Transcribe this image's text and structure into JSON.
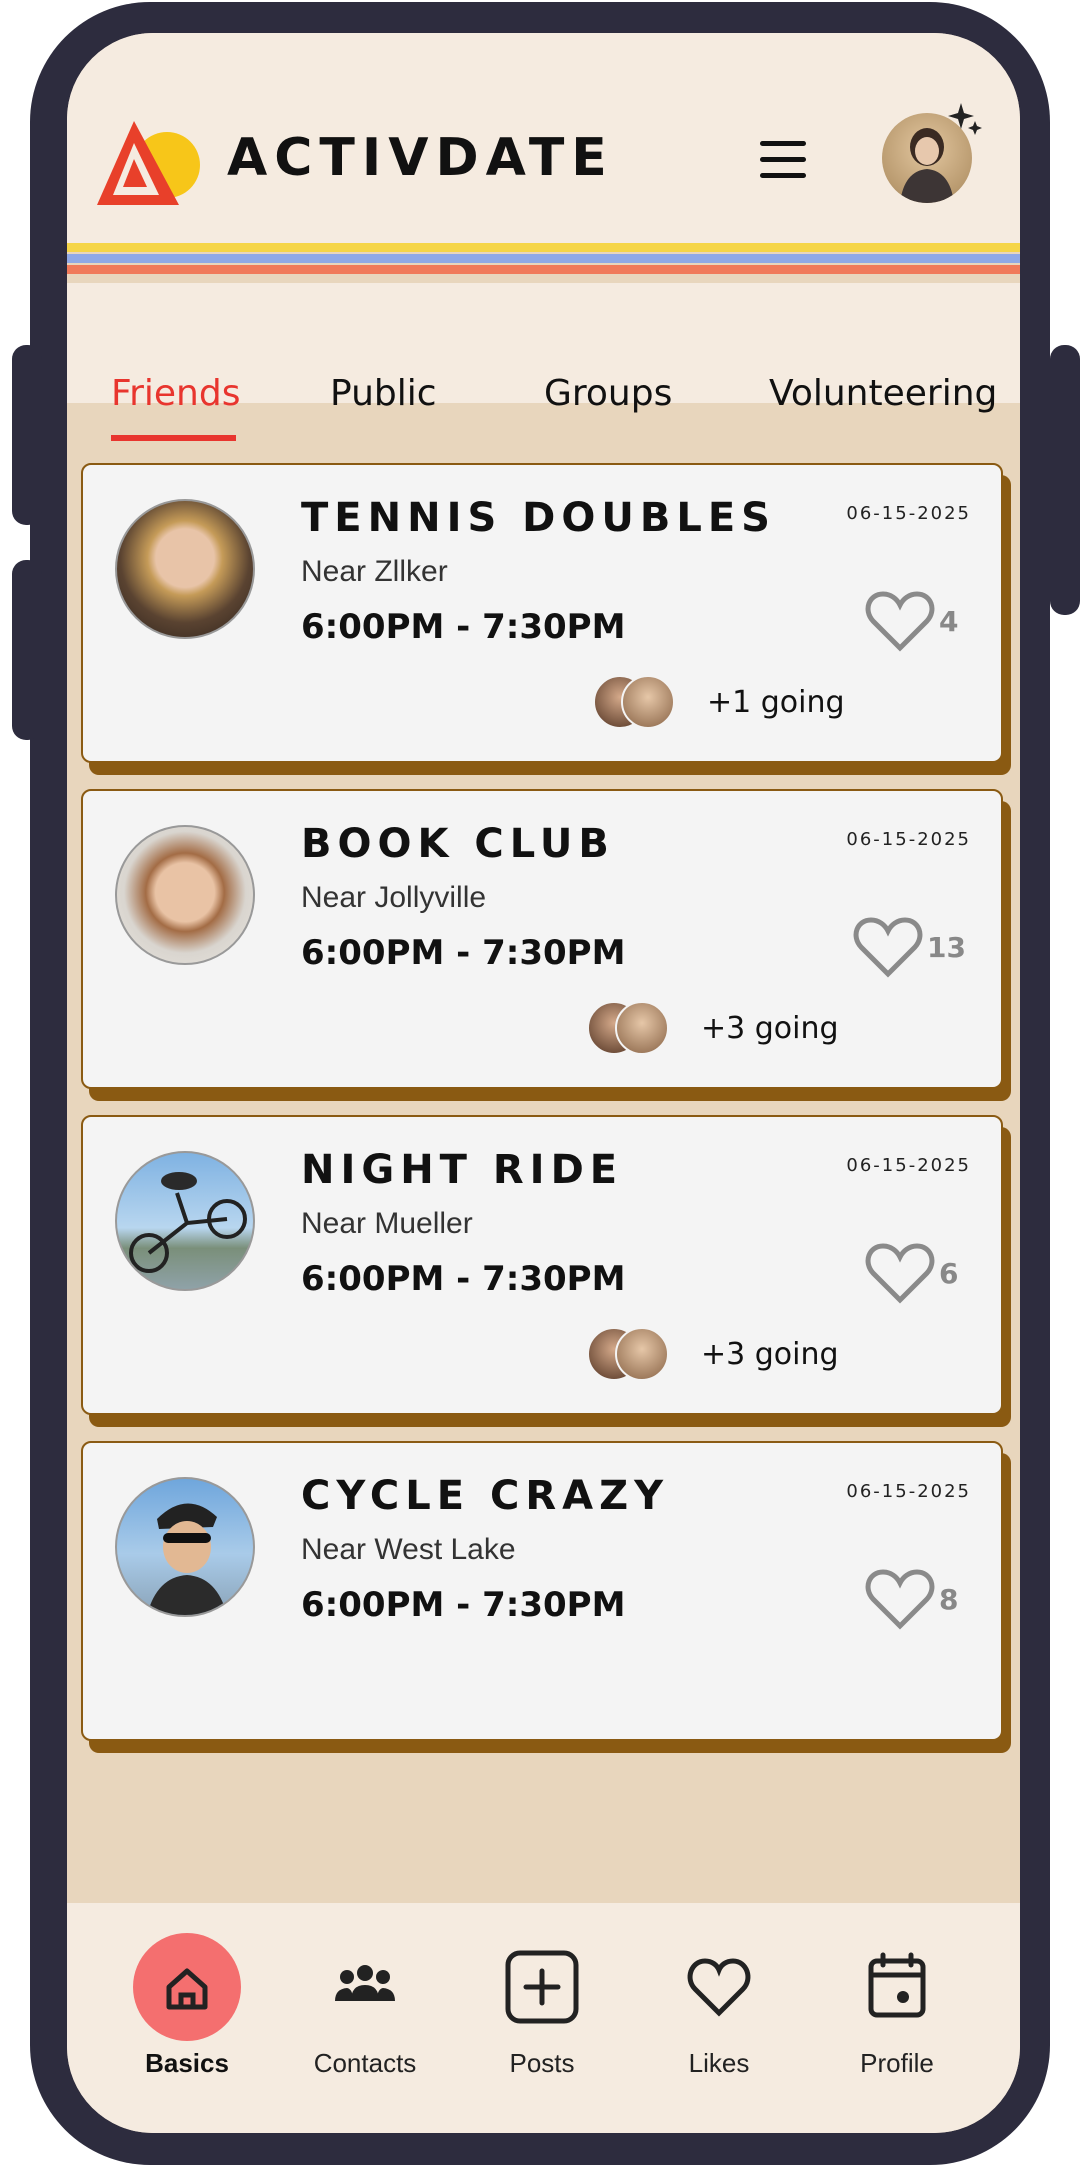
{
  "app": {
    "brand": "ACTIVDATE",
    "colors": {
      "accent": "#e8352e",
      "card_border": "#8a5a12",
      "stripe_yellow": "#f5d547",
      "stripe_blue": "#8fa9e6",
      "stripe_orange": "#f07a5a",
      "stripe_red": "#e8352e",
      "home_active": "#f46f6f"
    }
  },
  "header": {
    "menu_icon": "hamburger-menu-icon",
    "avatar_icon": "profile-avatar"
  },
  "tabs": [
    {
      "label": "Friends",
      "active": true
    },
    {
      "label": "Public",
      "active": false
    },
    {
      "label": "Groups",
      "active": false
    },
    {
      "label": "Volunteering",
      "active": false
    }
  ],
  "events": [
    {
      "title": "TENNIS DOUBLES",
      "date": "06-15-2025",
      "location": "Near Zllker",
      "time": "6:00PM - 7:30PM",
      "likes": "4",
      "going": "+1 going",
      "photo": "woman-portrait"
    },
    {
      "title": "BOOK CLUB",
      "date": "06-15-2025",
      "location": "Near Jollyville",
      "time": "6:00PM - 7:30PM",
      "likes": "13",
      "going": "+3 going",
      "photo": "man-portrait"
    },
    {
      "title": "NIGHT RIDE",
      "date": "06-15-2025",
      "location": "Near Mueller",
      "time": "6:00PM - 7:30PM",
      "likes": "6",
      "going": "+3 going",
      "photo": "bmx-rider"
    },
    {
      "title": "CYCLE CRAZY",
      "date": "06-15-2025",
      "location": "Near West Lake",
      "time": "6:00PM - 7:30PM",
      "likes": "8",
      "going": "",
      "photo": "cyclist-helmet"
    }
  ],
  "bottom_nav": [
    {
      "label": "Basics",
      "icon": "home-icon",
      "active": true
    },
    {
      "label": "Contacts",
      "icon": "people-icon",
      "active": false
    },
    {
      "label": "Posts",
      "icon": "add-square-icon",
      "active": false
    },
    {
      "label": "Likes",
      "icon": "heart-icon",
      "active": false
    },
    {
      "label": "Profile",
      "icon": "calendar-icon",
      "active": false
    }
  ]
}
